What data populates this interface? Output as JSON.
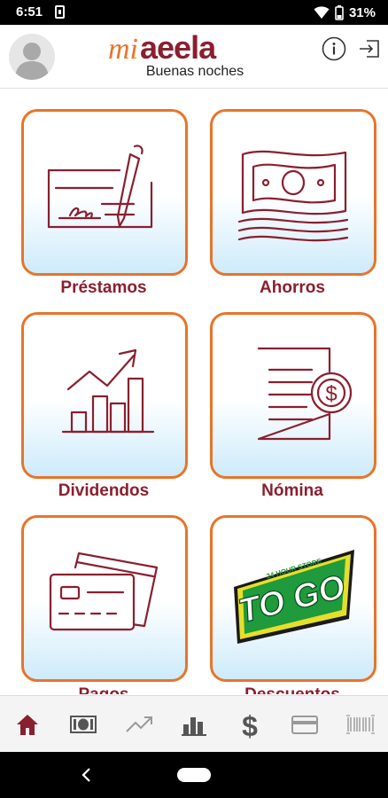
{
  "status_bar": {
    "time": "6:51",
    "battery_percent": "31%"
  },
  "header": {
    "logo_prefix": "mi",
    "logo_brand": "aeela",
    "greeting": "Buenas noches"
  },
  "tiles": [
    {
      "label": "Préstamos",
      "icon": "check-signing-icon"
    },
    {
      "label": "Ahorros",
      "icon": "banknote-icon"
    },
    {
      "label": "Dividendos",
      "icon": "growth-chart-icon"
    },
    {
      "label": "Nómina",
      "icon": "payroll-document-icon"
    },
    {
      "label": "Pagos",
      "icon": "credit-cards-icon"
    },
    {
      "label": "Descuentos",
      "icon": "togo-store-logo",
      "logo_text": "TO GO",
      "logo_ring_text": "24 HOUR STORE"
    }
  ],
  "bottom_nav": [
    {
      "name": "home",
      "icon": "home-icon",
      "active": true
    },
    {
      "name": "savings",
      "icon": "banknote-icon",
      "active": false
    },
    {
      "name": "dividends",
      "icon": "trend-icon",
      "active": false
    },
    {
      "name": "stats",
      "icon": "bar-chart-icon",
      "active": false
    },
    {
      "name": "payroll",
      "icon": "dollar-icon",
      "active": false
    },
    {
      "name": "cards",
      "icon": "card-icon",
      "active": false
    },
    {
      "name": "scan",
      "icon": "barcode-icon",
      "active": false
    }
  ],
  "colors": {
    "brand_maroon": "#8a1f2f",
    "accent_orange": "#e8742a",
    "tile_gradient_bottom": "#cdebfb",
    "togo_green": "#1f9a3c",
    "togo_yellow": "#e6df2a"
  }
}
